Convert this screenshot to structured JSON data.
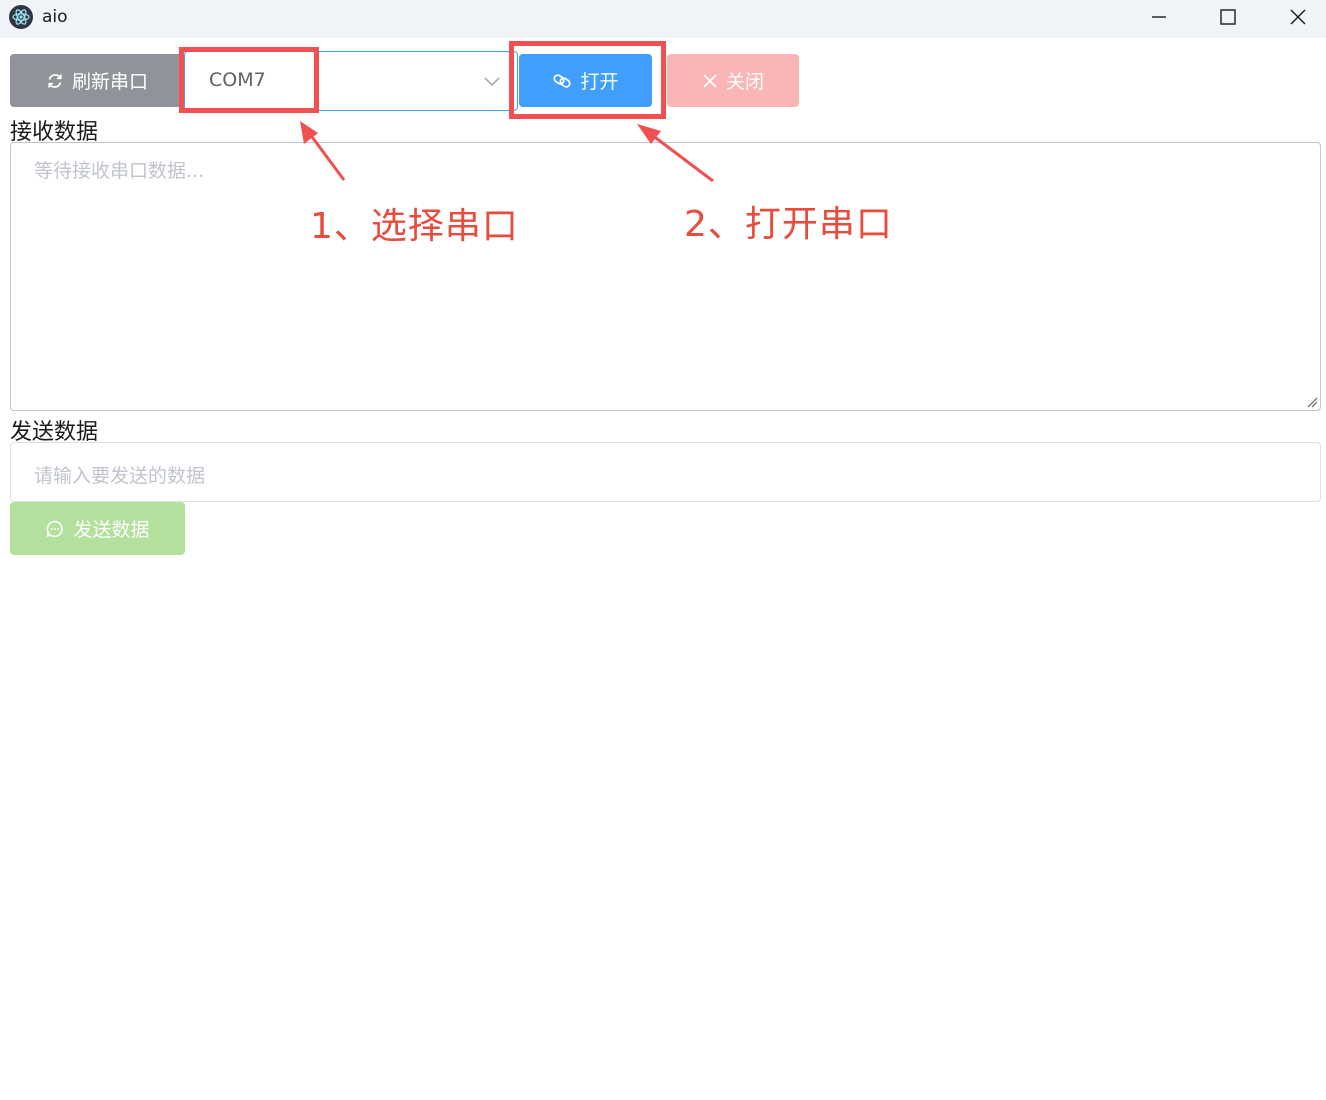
{
  "window": {
    "title": "aio",
    "icons": {
      "app": "electron-icon",
      "minimize": "minimize-icon",
      "maximize": "maximize-icon",
      "close": "close-icon"
    }
  },
  "toolbar": {
    "refresh_label": "刷新串口",
    "port_selected": "COM7",
    "open_label": "打开",
    "close_label": "关闭"
  },
  "receive": {
    "label": "接收数据",
    "placeholder": "等待接收串口数据..."
  },
  "send": {
    "label": "发送数据",
    "placeholder": "请输入要发送的数据",
    "button_label": "发送数据"
  },
  "annotations": {
    "step1": "1、选择串口",
    "step2": "2、打开串口"
  },
  "colors": {
    "refresh_bg": "#909399",
    "open_bg": "#409eff",
    "close_bg": "#fab6b6",
    "send_bg": "#b3e19d",
    "annotation": "#e74c3c"
  }
}
